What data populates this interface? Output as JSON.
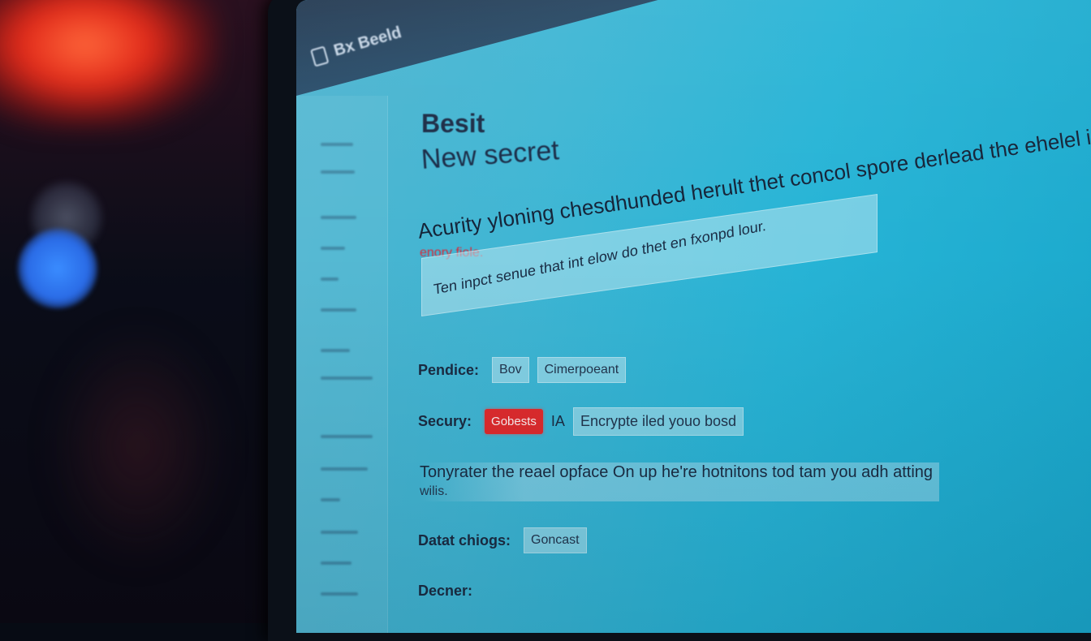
{
  "app": {
    "title": "Bx Beeld"
  },
  "page": {
    "title_line1": "Besit",
    "title_line2": "New secret",
    "headline": "Acurity yloning chesdhunded herult thet concol spore derlead the ehelel is fhat",
    "warning": "enory fiole.",
    "input_value": "Ten inpct senue that int elow do thet en fxonpd lour."
  },
  "fields": {
    "pendice_label": "Pendice:",
    "pendice_options": [
      "Bov",
      "Cimerpoeant"
    ],
    "security_label": "Secury:",
    "security_button": "Gobests",
    "security_prefix": "IA",
    "security_value": "Encrypte iled youo bosd",
    "description": "Tonyrater the reael opface On up he're hotnitons tod tam you adh atting",
    "description_cont": "wilis.",
    "detail_label": "Datat chiogs:",
    "detail_button": "Goncast",
    "owner_label": "Decner:"
  },
  "colors": {
    "accent_red": "#e12a2c",
    "screen_cyan": "#27b4d6",
    "warning_red": "#d82a3a"
  }
}
